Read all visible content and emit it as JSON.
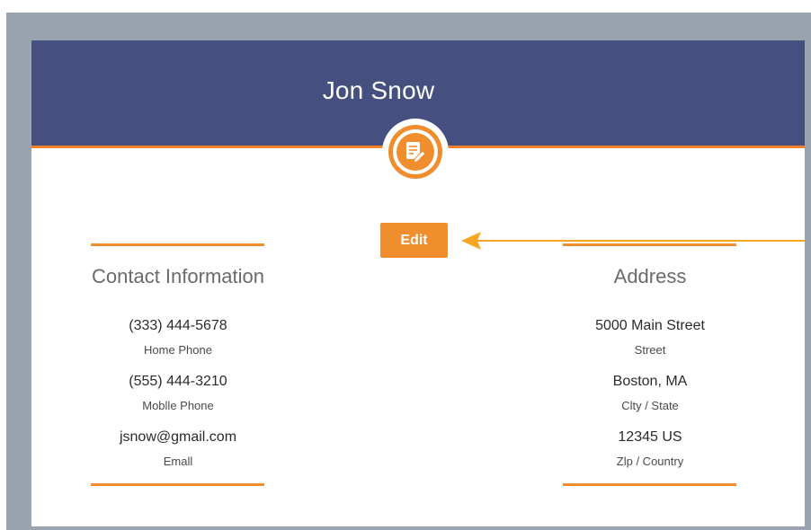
{
  "profile": {
    "name": "Jon Snow",
    "edit_label": "Edit",
    "badge_icon": "edit-note-icon"
  },
  "contact": {
    "title": "Contact Information",
    "items": [
      {
        "value": "(333) 444-5678",
        "label": "Home Phone"
      },
      {
        "value": "(555) 444-3210",
        "label": "Moblle Phone"
      },
      {
        "value": "jsnow@gmail.com",
        "label": "Emall"
      }
    ]
  },
  "address": {
    "title": "Address",
    "items": [
      {
        "value": "5000 Main Street",
        "label": "Street"
      },
      {
        "value": "Boston, MA",
        "label": "Clty / State"
      },
      {
        "value": "12345 US",
        "label": "Zlp / Country"
      }
    ]
  },
  "colors": {
    "header": "#455080",
    "accent": "#f08e2e",
    "frame": "#9aa4ae"
  }
}
